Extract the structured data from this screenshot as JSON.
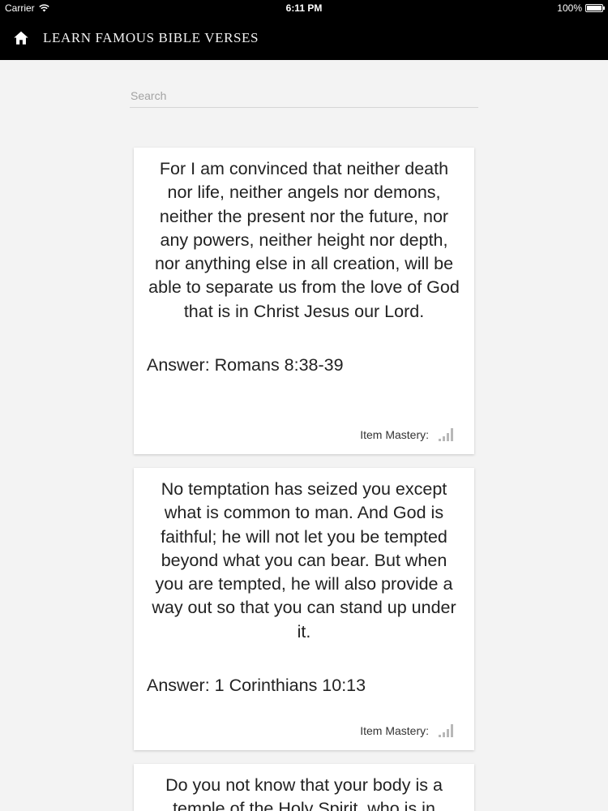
{
  "status_bar": {
    "carrier": "Carrier",
    "time": "6:11 PM",
    "battery": "100%"
  },
  "nav": {
    "title": "LEARN FAMOUS BIBLE VERSES",
    "home_icon": "home-icon"
  },
  "search": {
    "placeholder": "Search",
    "value": ""
  },
  "cards": [
    {
      "verse": "For I am convinced that neither death nor life, neither angels nor demons, neither the present nor the future, nor any powers, neither height nor depth, nor anything else in all creation, will be able to separate us from the love of God that is in Christ Jesus our Lord.",
      "answer": "Answer: Romans 8:38-39",
      "mastery_label": "Item Mastery:",
      "mastery_level": 0
    },
    {
      "verse": "No temptation has seized you except what is common to man. And God is faithful; he will not let you be tempted beyond what you can bear. But when you are tempted, he will also provide a way out so that you can stand up under it.",
      "answer": "Answer: 1 Corinthians 10:13",
      "mastery_label": "Item Mastery:",
      "mastery_level": 0
    },
    {
      "verse": "Do you not know that your body is a temple of the Holy Spirit, who is in",
      "answer": "",
      "mastery_label": "",
      "mastery_level": 0
    }
  ],
  "colors": {
    "nav_background": "#000000",
    "page_background": "#f3f3f3",
    "card_background": "#ffffff",
    "mastery_bars": "#b8b8b8"
  }
}
